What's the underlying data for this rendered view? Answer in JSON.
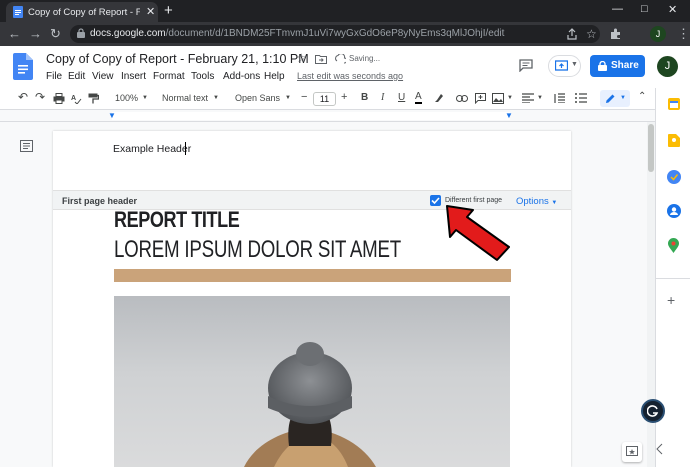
{
  "browser": {
    "tab_title": "Copy of Copy of Report - February",
    "tab_close": "✕",
    "new_tab": "+",
    "url_host": "docs.google.com",
    "url_path": "/document/d/1BNDM25FTmvmJ1uVi7wyGxGdO6eP8yNyEms3qMlJOhjI/edit",
    "avatar_letter": "J"
  },
  "docs": {
    "title": "Copy of Copy of Report - February 21, 1:10 PM",
    "saving": "Saving...",
    "last_edit": "Last edit was seconds ago",
    "menus": [
      "File",
      "Edit",
      "View",
      "Insert",
      "Format",
      "Tools",
      "Add-ons",
      "Help"
    ],
    "share_label": "Share",
    "avatar_letter": "J"
  },
  "toolbar": {
    "zoom": "100%",
    "style": "Normal text",
    "font": "Open Sans",
    "font_size": "11",
    "minus": "−",
    "plus": "+",
    "bold": "B",
    "italic": "I",
    "underline": "U",
    "text_color": "A"
  },
  "document": {
    "header_text": "Example Header",
    "header_bar_label": "First page header",
    "different_first_page_label": "Different first page",
    "different_first_page_checked": true,
    "options_label": "Options",
    "report_title": "REPORT TITLE",
    "subtitle": "LOREM IPSUM DOLOR SIT AMET"
  },
  "colors": {
    "accent": "#1a73e8",
    "tan_bar": "#caa37a",
    "annotation_arrow": "#e21b1b"
  },
  "icons": [
    "google-docs-icon",
    "star-icon",
    "move-folder-icon",
    "cloud-sync-icon",
    "comment-icon",
    "present-icon",
    "lock-icon",
    "share-page-icon",
    "bookmark-star-icon",
    "extensions-icon",
    "outline-icon",
    "undo-icon",
    "redo-icon",
    "print-icon",
    "paint-format-icon",
    "highlight-icon",
    "link-icon",
    "insert-comment-icon",
    "insert-image-icon",
    "align-icon",
    "line-spacing-icon",
    "checklist-icon",
    "editing-pencil-icon",
    "collapse-icon",
    "calendar-icon",
    "keep-icon",
    "tasks-icon",
    "contacts-icon",
    "maps-icon",
    "add-addon-icon",
    "explore-icon",
    "grammarly-icon"
  ]
}
